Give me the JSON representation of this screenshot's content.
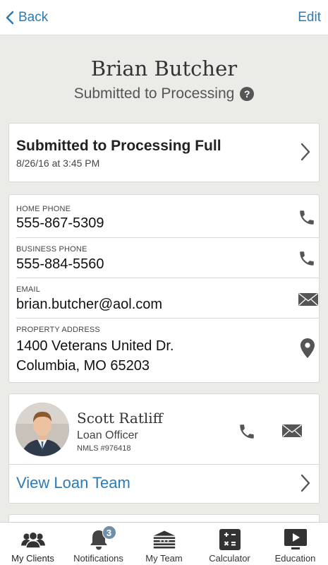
{
  "nav": {
    "back_label": "Back",
    "edit_label": "Edit"
  },
  "client": {
    "name": "Brian Butcher",
    "status": "Submitted to Processing",
    "help_glyph": "?"
  },
  "status_card": {
    "title": "Submitted to Processing Full",
    "date": "8/26/16 at 3:45 PM"
  },
  "contact": {
    "home_phone_label": "HOME PHONE",
    "home_phone": "555-867-5309",
    "business_phone_label": "BUSINESS PHONE",
    "business_phone": "555-884-5560",
    "email_label": "EMAIL",
    "email": "brian.butcher@aol.com",
    "address_label": "PROPERTY ADDRESS",
    "address_line1": "1400 Veterans United Dr.",
    "address_line2": "Columbia, MO 65203"
  },
  "officer": {
    "name": "Scott Ratliff",
    "title": "Loan Officer",
    "nmls": "NMLS #976418",
    "view_team_label": "View Loan Team"
  },
  "tabs": [
    {
      "label": "My Clients",
      "icon": "clients-icon",
      "active": true
    },
    {
      "label": "Notifications",
      "icon": "bell-icon",
      "badge": "3"
    },
    {
      "label": "My Team",
      "icon": "team-building-icon"
    },
    {
      "label": "Calculator",
      "icon": "calculator-icon"
    },
    {
      "label": "Education",
      "icon": "video-icon"
    }
  ],
  "colors": {
    "accent": "#2c7bb6",
    "background": "#ebebe8",
    "icon_gray": "#555555",
    "badge": "#6f8fa8"
  }
}
